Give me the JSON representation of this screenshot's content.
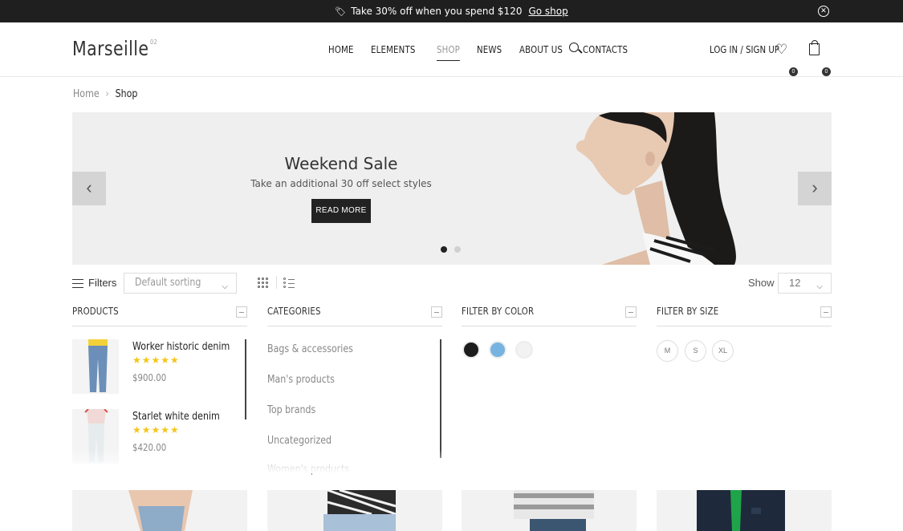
{
  "promo": {
    "text": "Take 30% off when you spend $120",
    "link": "Go shop"
  },
  "header": {
    "logo": "Marseille",
    "logo_sup": "02",
    "nav": [
      "HOME",
      "ELEMENTS",
      "SHOP",
      "NEWS",
      "ABOUT US",
      "CONTACTS"
    ],
    "active_nav": "SHOP",
    "login": "LOG IN / SIGN UP",
    "wishlist_count": "0",
    "cart_count": "0"
  },
  "breadcrumb": {
    "home": "Home",
    "current": "Shop"
  },
  "hero": {
    "title": "Weekend Sale",
    "subtitle": "Take an additional 30 off select styles",
    "button": "READ MORE",
    "slides": 2,
    "active_slide": 1
  },
  "toolbar": {
    "filters_label": "Filters",
    "sort_value": "Default sorting",
    "show_label": "Show",
    "show_value": "12"
  },
  "widgets": {
    "products": {
      "title": "PRODUCTS",
      "items": [
        {
          "name": "Worker historic denim",
          "stars": "★★★★★",
          "price": "$900.00"
        },
        {
          "name": "Starlet white denim",
          "stars": "★★★★★",
          "price": "$420.00"
        }
      ]
    },
    "categories": {
      "title": "CATEGORIES",
      "items": [
        "Bags & accessories",
        "Man's products",
        "Top brands",
        "Uncategorized",
        "Women's products"
      ]
    },
    "color": {
      "title": "FILTER BY COLOR",
      "swatches": [
        "#1c1c1c",
        "#76b3e0",
        "#f2f2f2"
      ]
    },
    "size": {
      "title": "FILTER BY SIZE",
      "sizes": [
        "M",
        "S",
        "XL"
      ]
    }
  }
}
